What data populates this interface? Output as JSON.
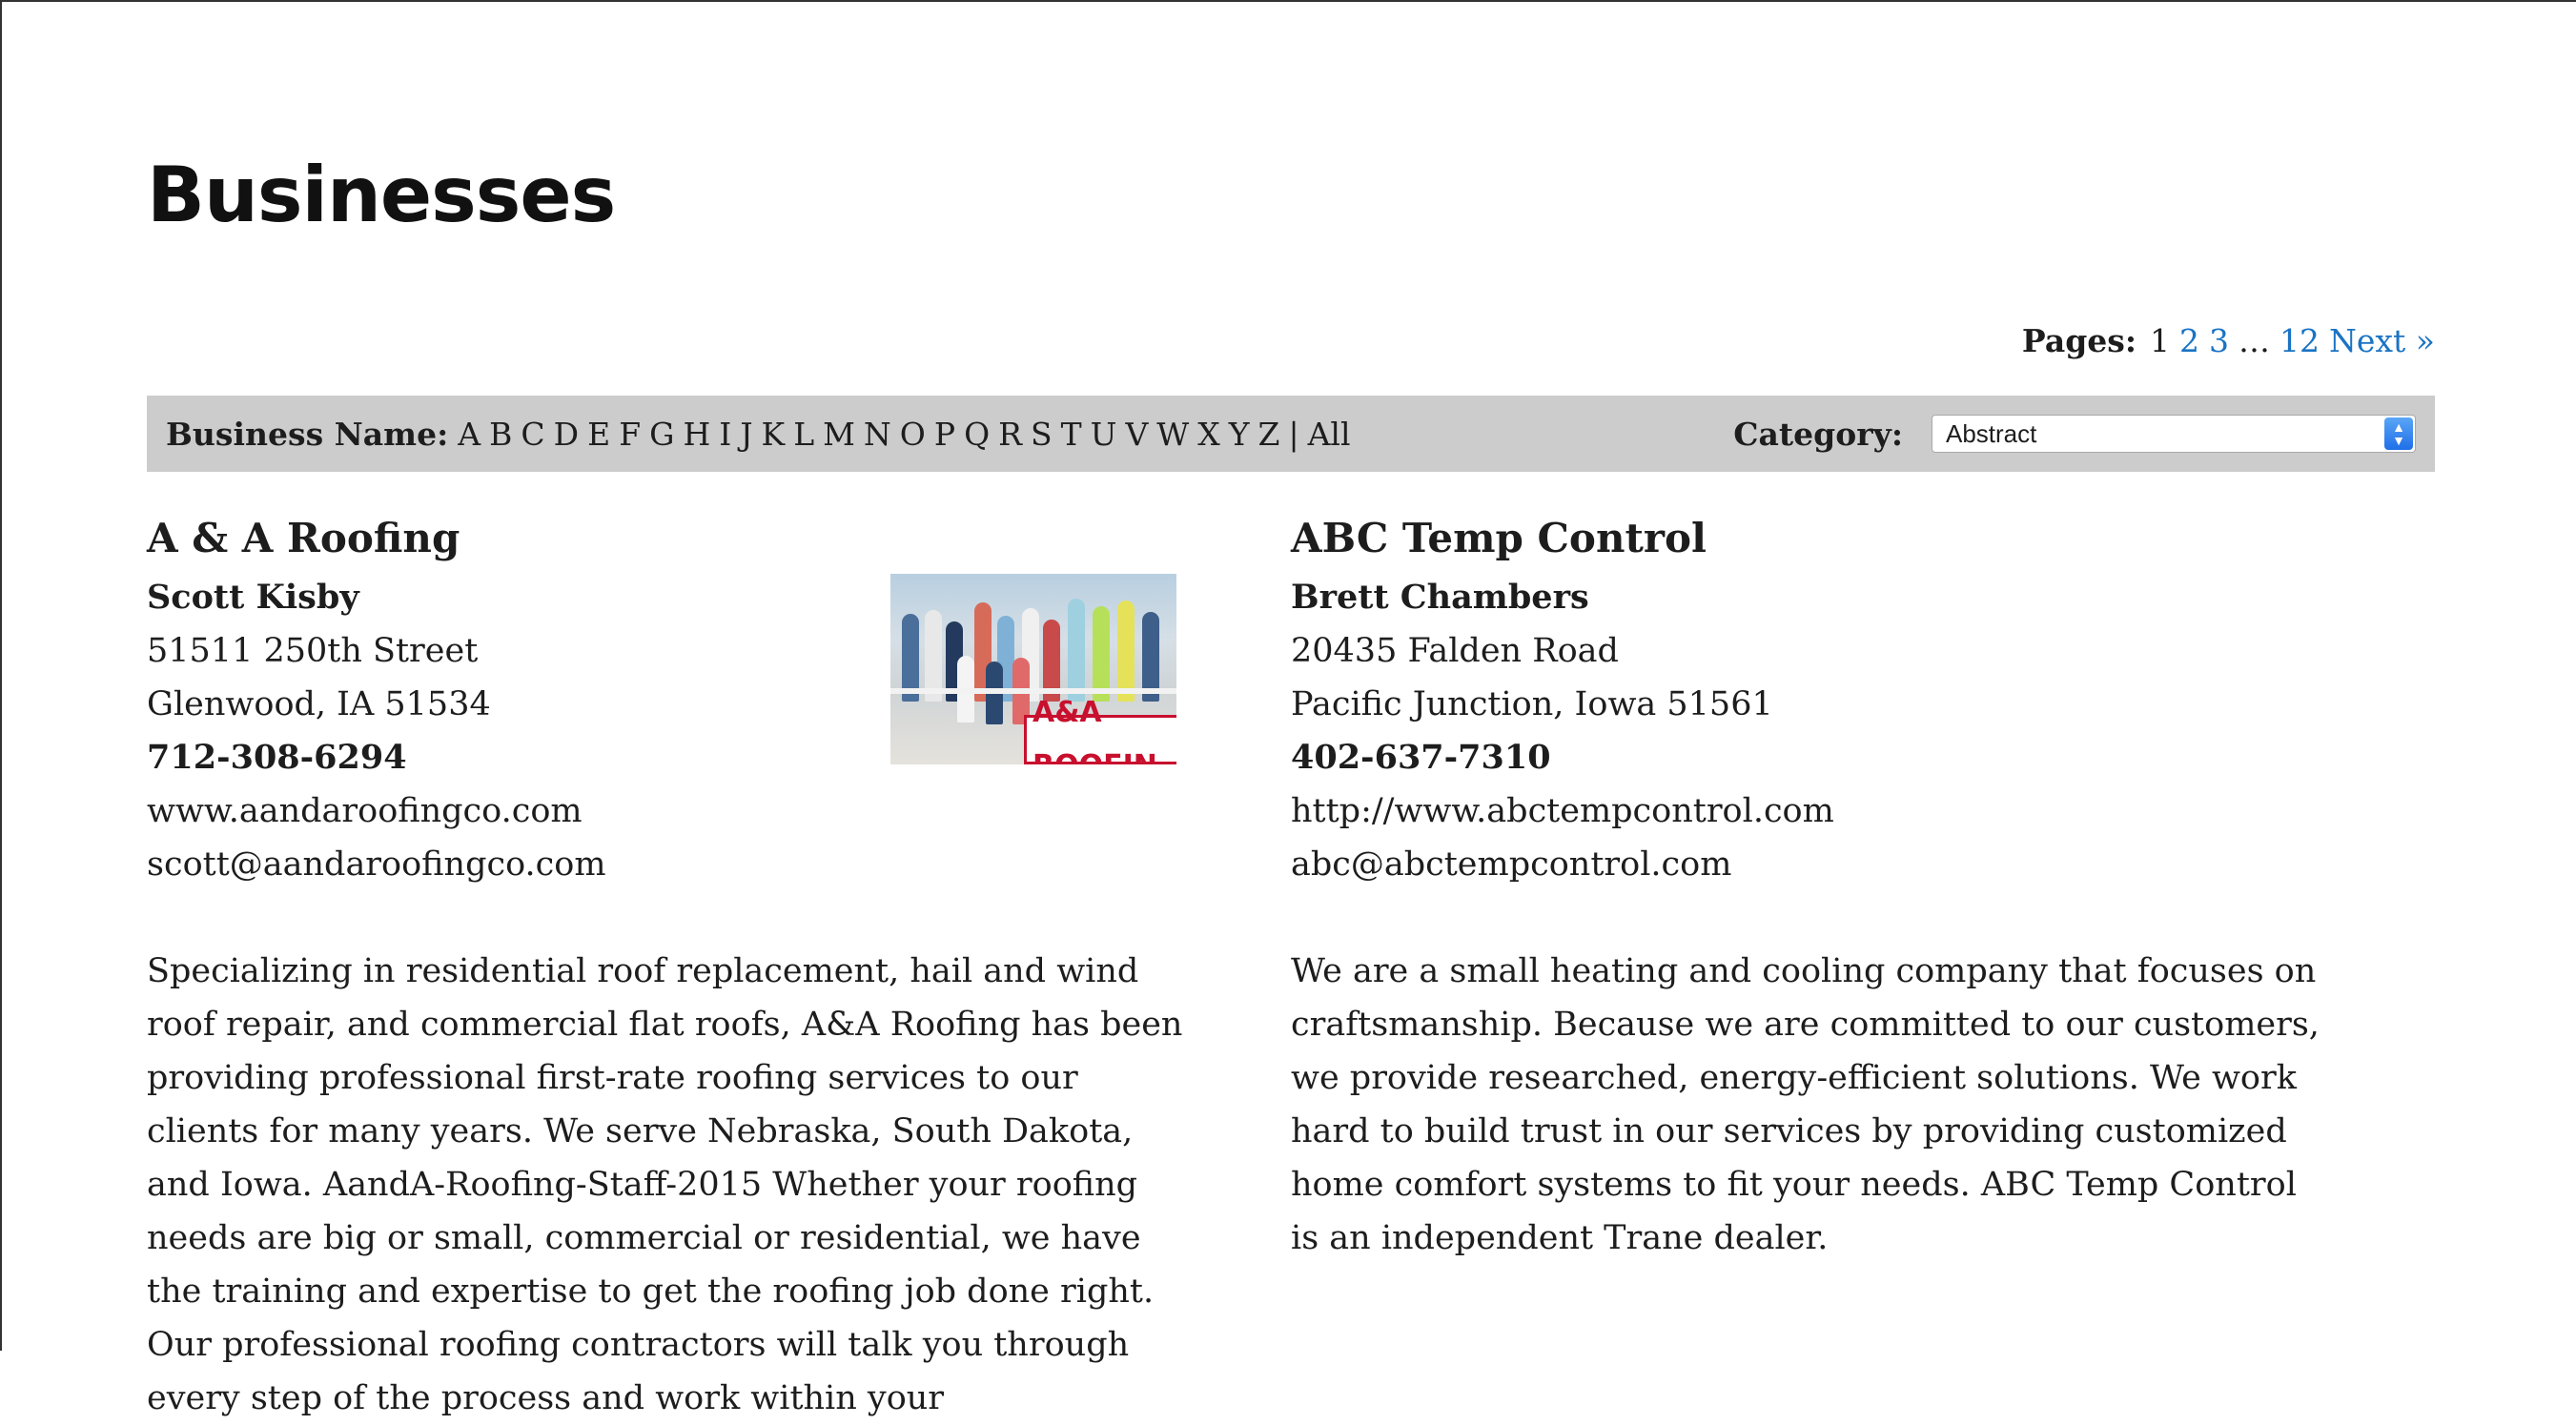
{
  "page": {
    "title": "Businesses"
  },
  "pagination": {
    "label": "Pages:",
    "current": "1",
    "links": [
      "2",
      "3"
    ],
    "ellipsis": "…",
    "last": "12",
    "next": "Next »"
  },
  "filter": {
    "name_label": "Business Name:",
    "letters": [
      "A",
      "B",
      "C",
      "D",
      "E",
      "F",
      "G",
      "H",
      "I",
      "J",
      "K",
      "L",
      "M",
      "N",
      "O",
      "P",
      "Q",
      "R",
      "S",
      "T",
      "U",
      "V",
      "W",
      "X",
      "Y",
      "Z"
    ],
    "separator": "|",
    "all": "All",
    "category_label": "Category:",
    "category_value": "Abstract"
  },
  "businesses": [
    {
      "name": "A & A Roofing",
      "contact": "Scott Kisby",
      "address1": "51511 250th Street",
      "address2": "Glenwood, IA 51534",
      "phone": "712-308-6294",
      "website": "www.aandaroofingco.com",
      "email": "scott@aandaroofingco.com",
      "image_banner": "A&A ROOFIN",
      "description": "Specializing in residential roof replacement, hail and wind roof repair, and commercial flat roofs, A&A Roofing has been providing professional first-rate roofing services to our clients for many years. We serve Nebraska, South Dakota, and Iowa. AandA-Roofing-Staff-2015 Whether your roofing needs are big or small, commercial or residential, we have the training and expertise to get the roofing job done right. Our professional roofing contractors will talk you through every step of the process and work within your"
    },
    {
      "name": "ABC Temp Control",
      "contact": "Brett Chambers",
      "address1": "20435 Falden Road",
      "address2": "Pacific Junction, Iowa 51561",
      "phone": "402-637-7310",
      "website": "http://www.abctempcontrol.com",
      "email": "abc@abctempcontrol.com",
      "description": "We are a small heating and cooling company that focuses on craftsmanship. Because we are committed to our customers, we provide researched, energy-efficient solutions. We work hard to build trust in our services by providing customized home comfort systems to fit your needs. ABC Temp Control is an independent Trane dealer."
    }
  ]
}
